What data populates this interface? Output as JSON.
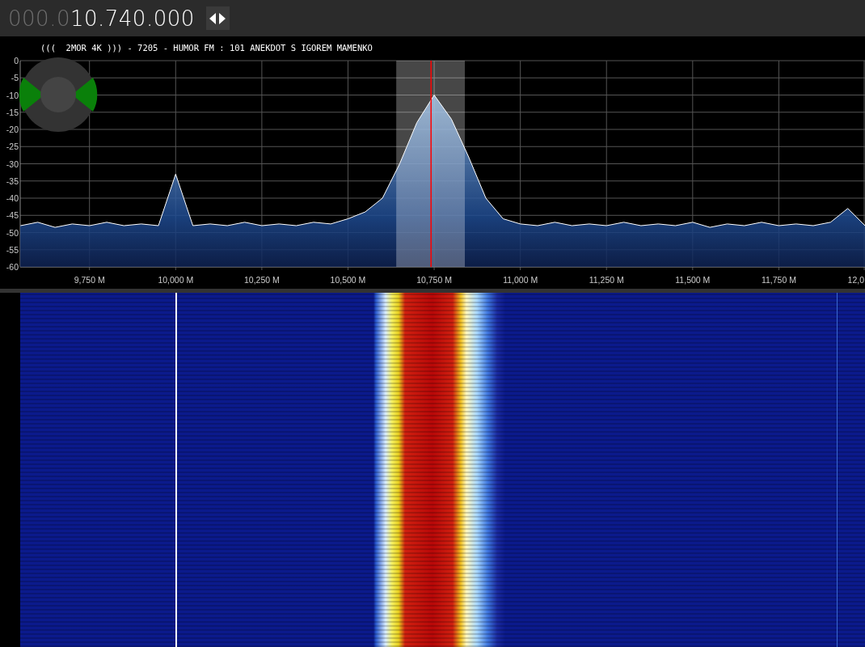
{
  "frequency": {
    "dim_digits": "000.0",
    "digits": "10.740.000"
  },
  "spectrum": {
    "title": "(((  2MOR 4K ))) - 7205 - HUMOR FM : 101 ANEKDOT S IGOREM MAMENKO",
    "chart_data": {
      "type": "area",
      "grid": true,
      "xlim": [
        9549,
        12000
      ],
      "ylim": [
        -60,
        0
      ],
      "bands": [
        {
          "axis": "x",
          "from": 10640,
          "to": 10839,
          "color": "#ffffff"
        }
      ],
      "ref_lines": [
        {
          "axis": "x",
          "value": 10741,
          "color": "#ff0000"
        }
      ],
      "yticks": [
        0,
        -5,
        -10,
        -15,
        -20,
        -25,
        -30,
        -35,
        -40,
        -45,
        -50,
        -55,
        -60
      ],
      "xticks": [
        {
          "value": 9750,
          "label": "9,750 M"
        },
        {
          "value": 10000,
          "label": "10,000 M"
        },
        {
          "value": 10250,
          "label": "10,250 M"
        },
        {
          "value": 10500,
          "label": "10,500 M"
        },
        {
          "value": 10750,
          "label": "10,750 M"
        },
        {
          "value": 11000,
          "label": "11,000 M"
        },
        {
          "value": 11250,
          "label": "11,250 M"
        },
        {
          "value": 11500,
          "label": "11,500 M"
        },
        {
          "value": 11750,
          "label": "11,750 M"
        }
      ],
      "x": [
        9550,
        9600,
        9650,
        9700,
        9750,
        9800,
        9850,
        9900,
        9950,
        10000,
        10050,
        10100,
        10150,
        10200,
        10250,
        10300,
        10350,
        10400,
        10450,
        10500,
        10550,
        10600,
        10650,
        10700,
        10750,
        10800,
        10850,
        10900,
        10950,
        11000,
        11050,
        11100,
        11150,
        11200,
        11250,
        11300,
        11350,
        11400,
        11450,
        11500,
        11550,
        11600,
        11650,
        11700,
        11750,
        11800,
        11850,
        11900,
        11950,
        12000
      ],
      "series": [
        {
          "color": "#ffffff",
          "values": [
            -48,
            -47,
            -48.5,
            -47.5,
            -48,
            -47,
            -48,
            -47.5,
            -48,
            -33,
            -48,
            -47.5,
            -48,
            -47,
            -48,
            -47.5,
            -48,
            -47,
            -47.5,
            -46,
            -44,
            -40,
            -30,
            -18,
            -10,
            -17,
            -28,
            -40,
            -46,
            -47.5,
            -48,
            -47,
            -48,
            -47.5,
            -48,
            -47,
            -48,
            -47.5,
            -48,
            -47,
            -48.5,
            -47.5,
            -48,
            -47,
            -48,
            -47.5,
            -48,
            -47,
            -43,
            -48
          ]
        }
      ]
    },
    "x_edge_label": "12,0"
  }
}
